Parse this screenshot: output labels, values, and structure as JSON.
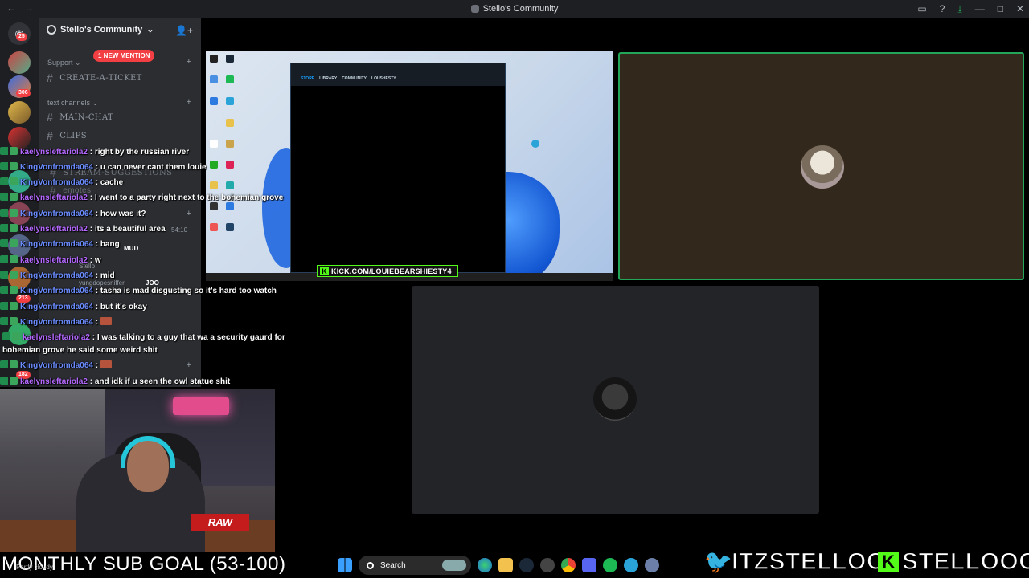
{
  "window": {
    "title": "Stello's Community"
  },
  "server": {
    "name": "Stello's Community",
    "mention_pill": "1 NEW MENTION",
    "rail_badges": [
      "25",
      "306",
      "213",
      "182"
    ]
  },
  "channels": {
    "categories": [
      {
        "name": "Support",
        "items": [
          "CREATE-A-TICKET"
        ]
      },
      {
        "name": "text channels",
        "items": [
          "MAIN-CHAT",
          "CLIPS",
          "STREAM-SUGGESTIONS",
          "emotes"
        ]
      }
    ],
    "voice_users": [
      "Stello",
      "yungdopesniffer"
    ],
    "voice_tags": [
      "MUD",
      "JOO"
    ],
    "voice_timer": "54:10"
  },
  "share": {
    "steam_tabs": [
      "STORE",
      "LIBRARY",
      "COMMUNITY",
      "LOUSHESTY"
    ],
    "banner": "KICK.COM/LOUIEBEARSHIESTY4"
  },
  "chat": {
    "messages": [
      {
        "user": "kaelynsleftariola2",
        "text": ": right by the russian river",
        "color": "purple"
      },
      {
        "user": "KingVonfromda064",
        "text": ": u can never cant them louie",
        "color": "blue"
      },
      {
        "user": "KingVonfromda064",
        "text": ": cache",
        "color": "blue"
      },
      {
        "user": "kaelynsleftariola2",
        "text": ": I went to a party right next to the bohemian grove",
        "color": "purple"
      },
      {
        "user": "KingVonfromda064",
        "text": ": how was it?",
        "color": "blue"
      },
      {
        "user": "kaelynsleftariola2",
        "text": ": its a beautiful area",
        "color": "purple"
      },
      {
        "user": "KingVonfromda064",
        "text": ": bang",
        "color": "blue"
      },
      {
        "user": "kaelynsleftariola2",
        "text": ": w",
        "color": "purple"
      },
      {
        "user": "KingVonfromda064",
        "text": ": mid",
        "color": "blue"
      },
      {
        "user": "KingVonfromda064",
        "text": ": tasha is mad disgusting so it's hard too watch",
        "color": "blue"
      },
      {
        "user": "KingVonfromda064",
        "text": ": but it's okay",
        "color": "blue"
      },
      {
        "user": "KingVonfromda064",
        "text": ":",
        "color": "blue"
      },
      {
        "user": "kaelynsleftariola2",
        "text": ": I was talking to a guy that wa a security gaurd for bohemian grove he said some weird shit",
        "color": "purple"
      },
      {
        "user": "KingVonfromda064",
        "text": ":",
        "color": "blue"
      },
      {
        "user": "kaelynsleftariola2",
        "text": ": and idk if u seen the owl statue shit",
        "color": "purple"
      }
    ]
  },
  "webcam": {
    "sign": "RAW"
  },
  "overlay": {
    "sub_goal": "MONTHLY SUB GOAL (53-100)",
    "weather": "Partly cloudy",
    "twitter_handle": "ITZSTELLOO",
    "kick_handle": "STELLOOO"
  },
  "taskbar": {
    "search_label": "Search"
  },
  "colors": {
    "speaking_ring": "#23a55a",
    "kick_green": "#53fc18",
    "mention_red": "#f23f43",
    "twitter_blue": "#1da1f2"
  }
}
